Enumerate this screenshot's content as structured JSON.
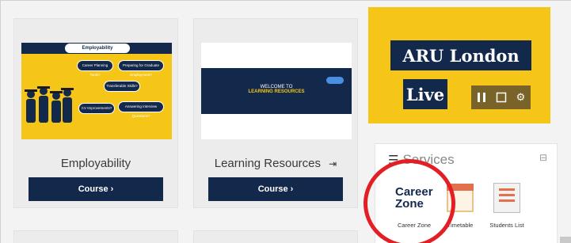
{
  "cards": [
    {
      "title": "Employability",
      "button_label": "Course",
      "image": {
        "heading": "Employability",
        "pills": [
          "Career Planning Tools?",
          "Preparing for Graduate Employment?",
          "Transferable Skills?",
          "CV Improvements?",
          "Answering Interview Questions?"
        ]
      }
    },
    {
      "title": "Learning Resources",
      "button_label": "Course",
      "image": {
        "line1": "WELCOME TO",
        "line2": "LEARNING RESOURCES"
      }
    }
  ],
  "live_panel": {
    "line1": "ARU London",
    "line2": "Live",
    "controls": [
      "pause-icon",
      "stop-icon",
      "settings-icon"
    ]
  },
  "services": {
    "header": "Services",
    "items": [
      {
        "logo_line1": "Career",
        "logo_line2": "Zone",
        "label": "Career Zone",
        "icon": "career-zone-logo"
      },
      {
        "label": "Timetable",
        "icon": "calendar-icon"
      },
      {
        "label": "Students List",
        "icon": "student-list-icon"
      }
    ]
  },
  "colors": {
    "navy": "#13294b",
    "yellow": "#f5c518",
    "highlight": "#e31e24"
  }
}
